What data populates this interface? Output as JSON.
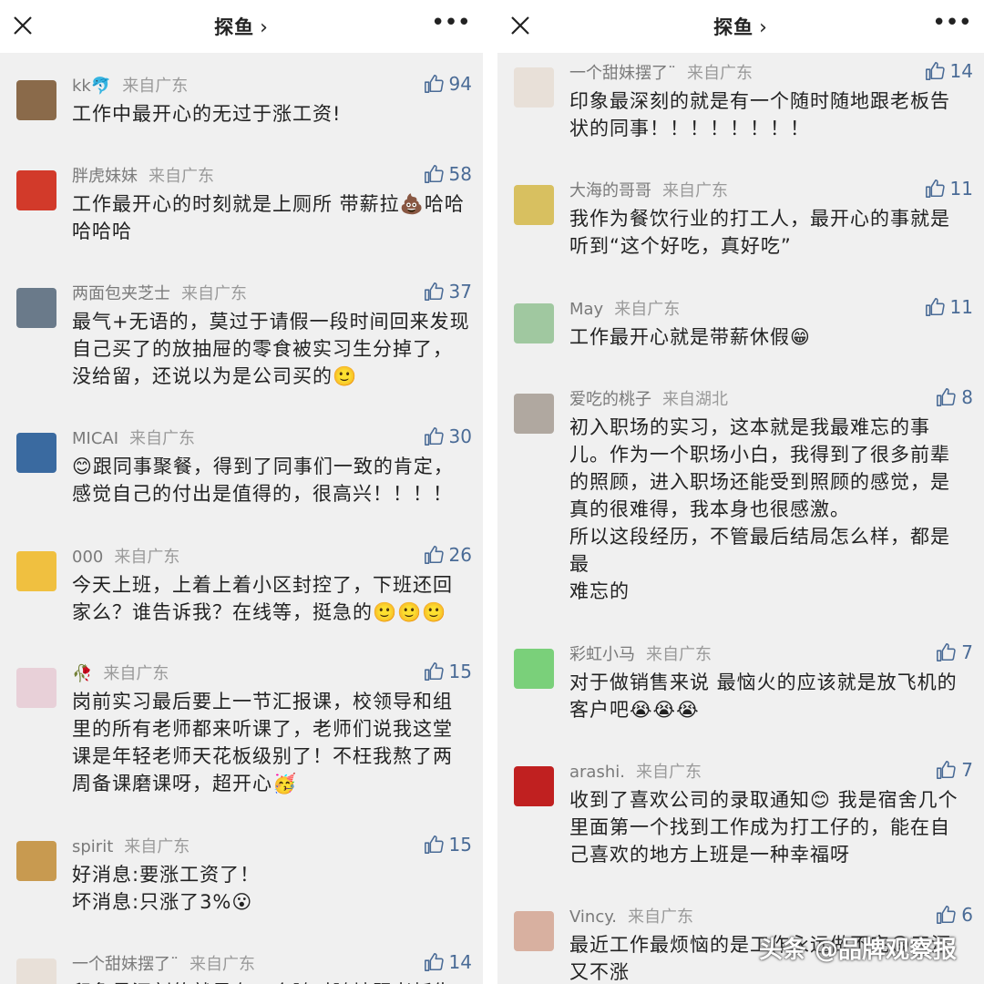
{
  "left": {
    "title": "探鱼",
    "comments": [
      {
        "name": "kk🐬",
        "location": "来自广东",
        "likes": "94",
        "lines": [
          "工作中最开心的无过于涨工资!"
        ]
      },
      {
        "name": "胖虎妹妹",
        "location": "来自广东",
        "likes": "58",
        "lines": [
          "工作最开心的时刻就是上厕所 带薪拉💩哈哈",
          "哈哈哈"
        ]
      },
      {
        "name": "两面包夹芝士",
        "location": "来自广东",
        "likes": "37",
        "lines": [
          "最气+无语的，莫过于请假一段时间回来发现",
          "自己买了的放抽屉的零食被实习生分掉了，",
          "没给留，还说以为是公司买的🙂"
        ]
      },
      {
        "name": "MICAI",
        "location": "来自广东",
        "likes": "30",
        "lines": [
          "😊跟同事聚餐，得到了同事们一致的肯定，",
          "感觉自己的付出是值得的，很高兴！！！！"
        ]
      },
      {
        "name": "000",
        "location": "来自广东",
        "likes": "26",
        "lines": [
          "今天上班，上着上着小区封控了，下班还回",
          "家么？谁告诉我？在线等，挺急的🙂🙂🙂"
        ]
      },
      {
        "name": "🥀",
        "location": "来自广东",
        "likes": "15",
        "lines": [
          "岗前实习最后要上一节汇报课，校领导和组",
          "里的所有老师都来听课了，老师们说我这堂",
          "课是年轻老师天花板级别了！不枉我熬了两",
          "周备课磨课呀，超开心🥳"
        ]
      },
      {
        "name": "spirit",
        "location": "来自广东",
        "likes": "15",
        "lines": [
          "好消息:要涨工资了！",
          "坏消息:只涨了3%😮"
        ]
      },
      {
        "name": "一个甜妹摆了¨",
        "location": "来自广东",
        "likes": "14",
        "lines": [
          "印象最深刻的就是有一个随时随地跟老板告"
        ]
      }
    ]
  },
  "right": {
    "title": "探鱼",
    "comments": [
      {
        "name": "一个甜妹摆了¨",
        "location": "来自广东",
        "likes": "14",
        "lines": [
          "印象最深刻的就是有一个随时随地跟老板告",
          "状的同事！！！！！！！！"
        ]
      },
      {
        "name": "大海的哥哥",
        "location": "来自广东",
        "likes": "11",
        "lines": [
          "我作为餐饮行业的打工人，最开心的事就是",
          "听到“这个好吃，真好吃”"
        ]
      },
      {
        "name": "May",
        "location": "来自广东",
        "likes": "11",
        "lines": [
          "工作最开心就是带薪休假😁"
        ]
      },
      {
        "name": "爱吃的桃子",
        "location": "来自湖北",
        "likes": "8",
        "lines": [
          "初入职场的实习，这本就是我最难忘的事",
          "儿。作为一个职场小白，我得到了很多前辈",
          "的照顾，进入职场还能受到照顾的感觉，是",
          "真的很难得，我本身也很感激。",
          "所以这段经历，不管最后结局怎么样，都是",
          "最",
          "难忘的"
        ]
      },
      {
        "name": "彩虹小马",
        "location": "来自广东",
        "likes": "7",
        "lines": [
          "对于做销售来说 最恼火的应该就是放飞机的",
          "客户吧😭😭😭"
        ]
      },
      {
        "name": "arashi.",
        "location": "来自广东",
        "likes": "7",
        "lines": [
          "收到了喜欢公司的录取通知😊 我是宿舍几个",
          "里面第一个找到工作成为打工仔的，能在自",
          "己喜欢的地方上班是一种幸福呀"
        ]
      },
      {
        "name": "Vincy.",
        "location": "来自广东",
        "likes": "6",
        "lines": [
          "最近工作最烦恼的是工作永远做不完😩天涯",
          "又不涨"
        ]
      }
    ]
  },
  "watermark": "头条 @品牌观察报",
  "colors": {
    "accent": "#4a6b96",
    "background": "#f0f0f0",
    "topbar": "#ffffff"
  }
}
